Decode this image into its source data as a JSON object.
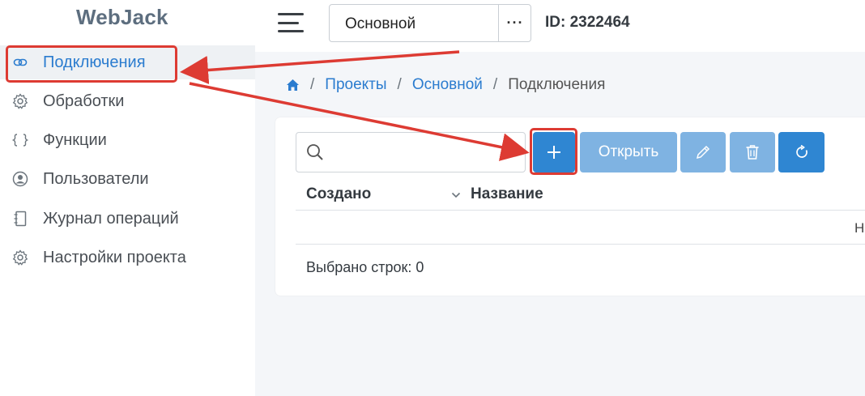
{
  "app": {
    "title": "WebJack"
  },
  "sidebar": {
    "items": [
      {
        "label": "Подключения",
        "icon": "link-icon",
        "active": true
      },
      {
        "label": "Обработки",
        "icon": "gear-icon"
      },
      {
        "label": "Функции",
        "icon": "braces-icon"
      },
      {
        "label": "Пользователи",
        "icon": "user-circle-icon"
      },
      {
        "label": "Журнал операций",
        "icon": "journal-icon"
      },
      {
        "label": "Настройки проекта",
        "icon": "gear-icon"
      }
    ]
  },
  "header": {
    "project_select": {
      "value": "Основной",
      "more": "···"
    },
    "project_id": "ID: 2322464"
  },
  "breadcrumb": {
    "items": [
      "Проекты",
      "Основной",
      "Подключения"
    ],
    "separator": "/"
  },
  "toolbar": {
    "search_placeholder": "",
    "add_label": "+",
    "open_label": "Открыть"
  },
  "table": {
    "columns": [
      "Создано",
      "Название"
    ],
    "cut_off_text": "Н",
    "footer": "Выбрано строк: 0"
  },
  "colors": {
    "accent": "#2f86d2",
    "accent_disabled": "#7fb3e2",
    "link": "#2b7ccf",
    "annotation": "#dd3b33"
  }
}
